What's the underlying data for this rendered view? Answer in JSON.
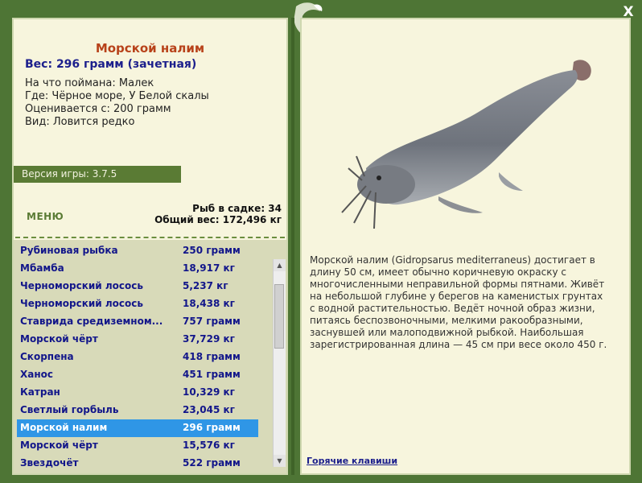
{
  "colors": {
    "frame": "#4e7535",
    "panel": "#f7f5dd",
    "title": "#b8421a",
    "link": "#1c1f8c",
    "selected": "#2f96e6"
  },
  "window": {
    "close_label": "X"
  },
  "fish": {
    "name": "Морской налим",
    "weight_line": "Вес: 296 грамм (зачетная)",
    "bait": "На что поймана: Малек",
    "place": "Где: Чёрное море, У Белой скалы",
    "rated_from": "Оценивается с: 200 грамм",
    "kind": "Вид: Ловится редко"
  },
  "version": "Версия игры: 3.7.5",
  "menu_label": "МЕНЮ",
  "cage": {
    "count_line": "Рыб в садке: 34",
    "total_line": "Общий вес: 172,496 кг"
  },
  "catch_list": [
    {
      "name": "Рубиновая рыбка",
      "weight": "250 грамм"
    },
    {
      "name": "Мбамба",
      "weight": "18,917 кг"
    },
    {
      "name": "Черноморский лосось",
      "weight": "5,237 кг"
    },
    {
      "name": "Черноморский лосось",
      "weight": "18,438 кг"
    },
    {
      "name": "Ставрида средиземном...",
      "weight": "757 грамм"
    },
    {
      "name": "Морской чёрт",
      "weight": "37,729 кг"
    },
    {
      "name": "Скорпена",
      "weight": "418 грамм"
    },
    {
      "name": "Ханос",
      "weight": "451 грамм"
    },
    {
      "name": "Катран",
      "weight": "10,329 кг"
    },
    {
      "name": "Светлый горбыль",
      "weight": "23,045 кг"
    },
    {
      "name": "Морской налим",
      "weight": "296 грамм",
      "selected": true
    },
    {
      "name": "Морской чёрт",
      "weight": "15,576 кг"
    },
    {
      "name": "Звездочёт",
      "weight": "522 грамм"
    }
  ],
  "description": "Морской налим (Gidropsarus mediterraneus) достигает в длину 50 см, имеет обычно коричневую окраску с многочисленными неправильной формы пятнами. Живёт на небольшой глубине у берегов на каменистых грунтах с водной растительностью. Ведёт ночной образ жизни, питаясь беспозвоночными, мелкими ракообразными, заснувшей или малоподвижной рыбкой. Наибольшая зарегистрированная длина — 45 см при весе около 450 г.",
  "hotkeys_label": "Горячие клавиши"
}
